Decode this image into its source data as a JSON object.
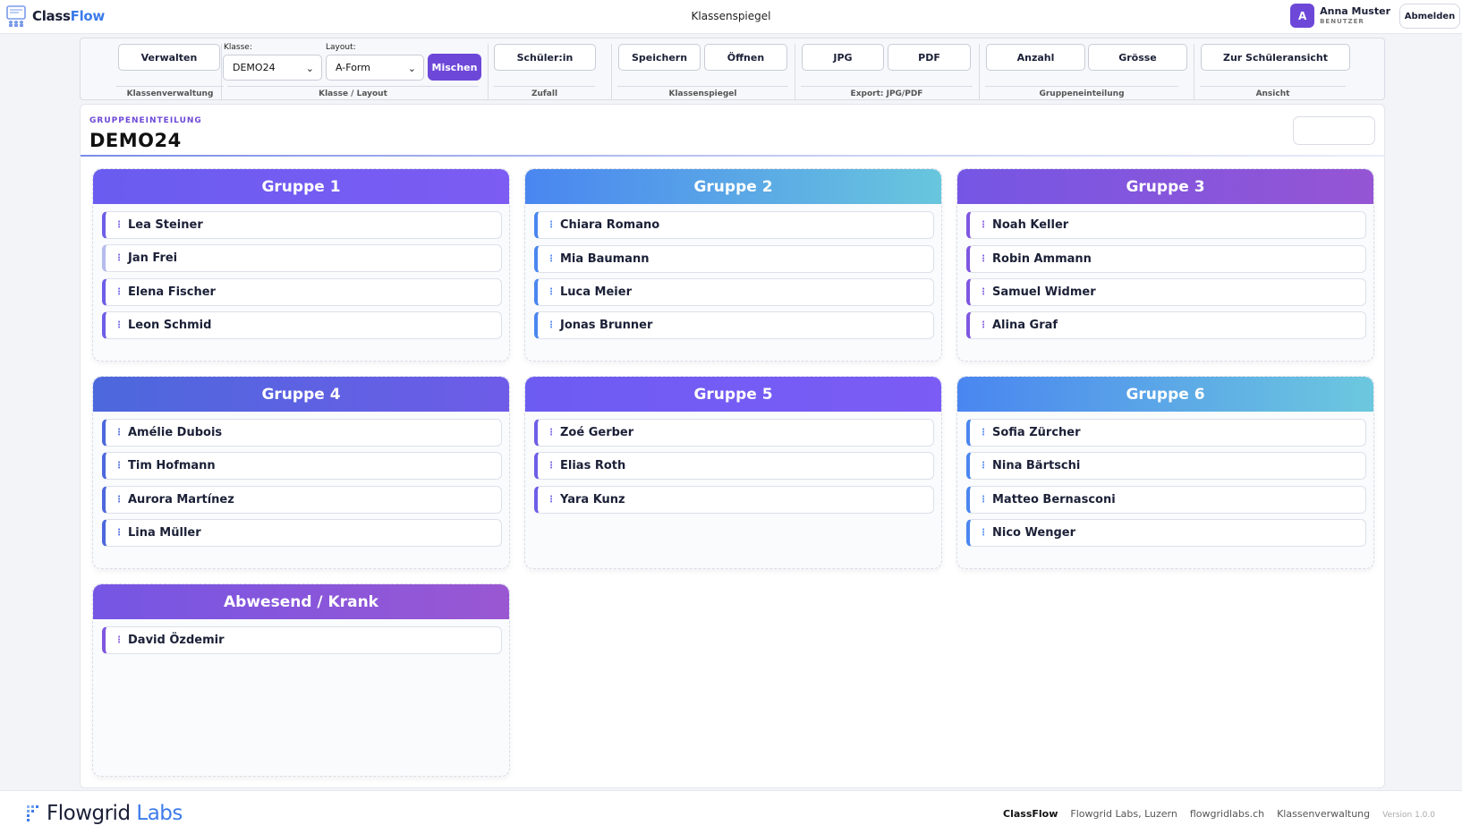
{
  "app": {
    "brand": "Class",
    "brand_accent": "Flow",
    "page_title": "Klassenspiegel"
  },
  "user": {
    "initial": "A",
    "name": "Anna Muster",
    "role": "BENUTZER",
    "logout": "Abmelden"
  },
  "toolbar": {
    "manage": "Verwalten",
    "manage_group": "Klassenverwaltung",
    "class_label": "Klasse:",
    "class_value": "DEMO24",
    "layout_label": "Layout:",
    "layout_value": "A-Form",
    "mix": "Mischen",
    "class_layout_group": "Klasse / Layout",
    "random_student": "Schüler:in",
    "random_group": "Zufall",
    "save": "Speichern",
    "open": "Öffnen",
    "seating_group": "Klassenspiegel",
    "jpg": "JPG",
    "pdf": "PDF",
    "export_group": "Export: JPG/PDF",
    "count": "Anzahl",
    "size": "Grösse",
    "grouping_group": "Gruppeneinteilung",
    "student_view": "Zur Schüleransicht",
    "view_group": "Ansicht"
  },
  "panel": {
    "kicker": "GRUPPENEINTEILUNG",
    "title": "DEMO24"
  },
  "groups": [
    {
      "name": "Gruppe 1",
      "students": [
        "Lea Steiner",
        "Jan Frei",
        "Elena Fischer",
        "Leon Schmid"
      ]
    },
    {
      "name": "Gruppe 2",
      "students": [
        "Chiara Romano",
        "Mia Baumann",
        "Luca Meier",
        "Jonas Brunner"
      ]
    },
    {
      "name": "Gruppe 3",
      "students": [
        "Noah Keller",
        "Robin Ammann",
        "Samuel Widmer",
        "Alina Graf"
      ]
    },
    {
      "name": "Gruppe 4",
      "students": [
        "Amélie Dubois",
        "Tim Hofmann",
        "Aurora Martínez",
        "Lina Müller"
      ]
    },
    {
      "name": "Gruppe 5",
      "students": [
        "Zoé Gerber",
        "Elias Roth",
        "Yara Kunz"
      ]
    },
    {
      "name": "Gruppe 6",
      "students": [
        "Sofia Zürcher",
        "Nina Bärtschi",
        "Matteo Bernasconi",
        "Nico Wenger"
      ]
    },
    {
      "name": "Abwesend / Krank",
      "students": [
        "David Özdemir"
      ]
    }
  ],
  "footer": {
    "brand": "Flowgrid",
    "brand_accent": "Labs",
    "link_app": "ClassFlow",
    "link_company": "Flowgrid Labs, Luzern",
    "link_site": "flowgridlabs.ch",
    "link_admin": "Klassenverwaltung",
    "version": "Version 1.0.0"
  },
  "colors": {
    "accent": "#6d48d8",
    "brand_blue": "#3d7bea",
    "text_dark": "#1b2037"
  }
}
